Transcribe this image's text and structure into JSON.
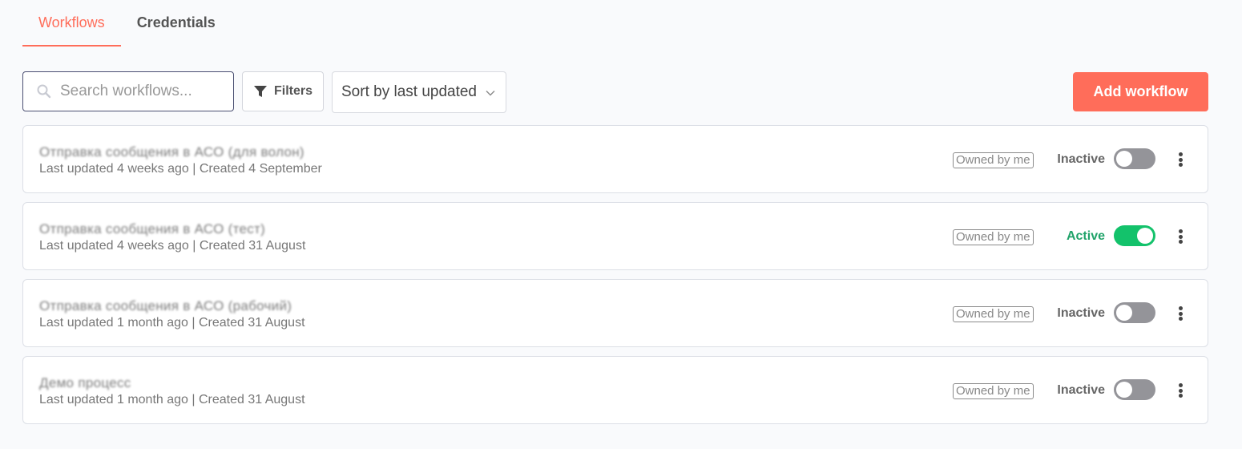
{
  "tabs": [
    {
      "label": "Workflows",
      "active": true
    },
    {
      "label": "Credentials",
      "active": false
    }
  ],
  "toolbar": {
    "search_placeholder": "Search workflows...",
    "filters_label": "Filters",
    "sort_label": "Sort by last updated",
    "add_label": "Add workflow"
  },
  "workflows": [
    {
      "title": "Отправка сообщения в АСО (для волон)",
      "subtitle": "Last updated 4 weeks ago | Created 4 September",
      "owner": "Owned by me",
      "status": "Inactive",
      "active": false
    },
    {
      "title": "Отправка сообщения в АСО (тест)",
      "subtitle": "Last updated 4 weeks ago | Created 31 August",
      "owner": "Owned by me",
      "status": "Active",
      "active": true
    },
    {
      "title": "Отправка сообщения в АСО (рабочий)",
      "subtitle": "Last updated 1 month ago | Created 31 August",
      "owner": "Owned by me",
      "status": "Inactive",
      "active": false
    },
    {
      "title": "Демо процесс",
      "subtitle": "Last updated 1 month ago | Created 31 August",
      "owner": "Owned by me",
      "status": "Inactive",
      "active": false
    }
  ],
  "colors": {
    "accent": "#ff6d5a",
    "active_green": "#13c26b",
    "inactive_gray": "#949499"
  }
}
